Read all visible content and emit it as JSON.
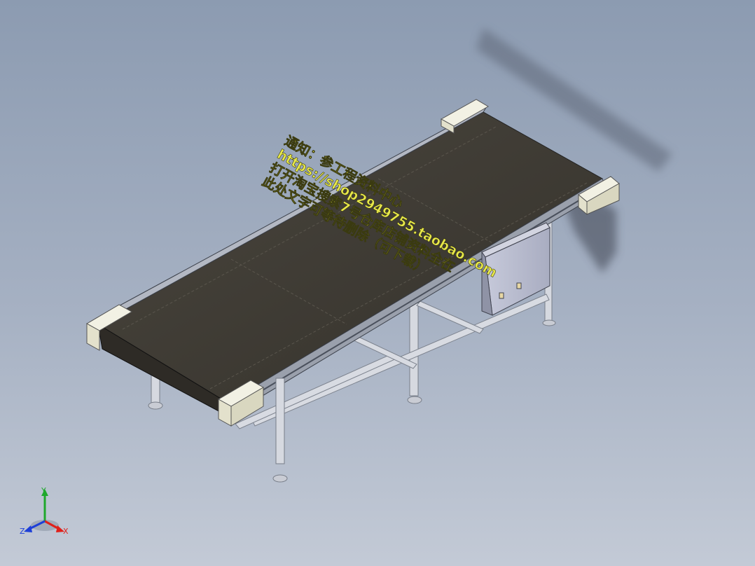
{
  "scene": {
    "object": "belt-conveyor-assembly",
    "watermark_lines": [
      "通知：参工程资料中心",
      "https://shop2949755.taobao.com",
      "打开淘宝搜索7号仓库店铺资料全在",
      "此处文字可等待删除（可下载）"
    ]
  },
  "triad": {
    "x_label": "X",
    "y_label": "Y",
    "z_label": "Z",
    "x_color": "#e0201a",
    "y_color": "#1fa82c",
    "z_color": "#1d3fd8"
  },
  "colors": {
    "belt": "#3d3a34",
    "frame": "#cfd3dc",
    "end_cap": "#ecebdc",
    "control_box": "#b9bccf"
  }
}
